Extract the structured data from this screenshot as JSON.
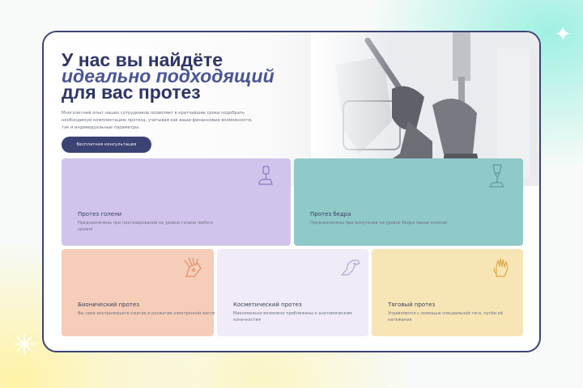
{
  "hero": {
    "title_line1": "У нас вы найдёте",
    "title_line2": "идеально подходящий",
    "title_line3": "для вас протез",
    "description": "Многолетний опыт наших сотрудников позволяет в кратчайшие сроки подобрать необходимую комплектацию протеза, учитывая как ваши финансовые возможности, так и индивидуальные параметры.",
    "cta_label": "бесплатная консультация"
  },
  "cards": [
    {
      "title": "Протез голени",
      "description": "Предназначены при протезировании на уровне голени любого уровня",
      "icon": "shin-prosthesis-icon",
      "color": "#d0c4ec"
    },
    {
      "title": "Протез бедра",
      "description": "Предназначены при ампутации на уровне бедра (выше колена)",
      "icon": "thigh-prosthesis-icon",
      "color": "#8fc9c8"
    },
    {
      "title": "Бионический протез",
      "description": "Вы сами контролируете сжатие и разжатие электронной кисти",
      "icon": "bionic-hand-icon",
      "color": "#f5cdb8"
    },
    {
      "title": "Косметический протез",
      "description": "Максимально возможно приближены к анатомическим конечностям",
      "icon": "cosmetic-hand-icon",
      "color": "#f0ebf6"
    },
    {
      "title": "Тяговый протез",
      "description": "Управляются с помощью специальной тяги, путём её натяжения",
      "icon": "traction-hand-icon",
      "color": "#f8e5b6"
    }
  ],
  "colors": {
    "accent": "#3b4374",
    "frame": "#3b4374"
  }
}
